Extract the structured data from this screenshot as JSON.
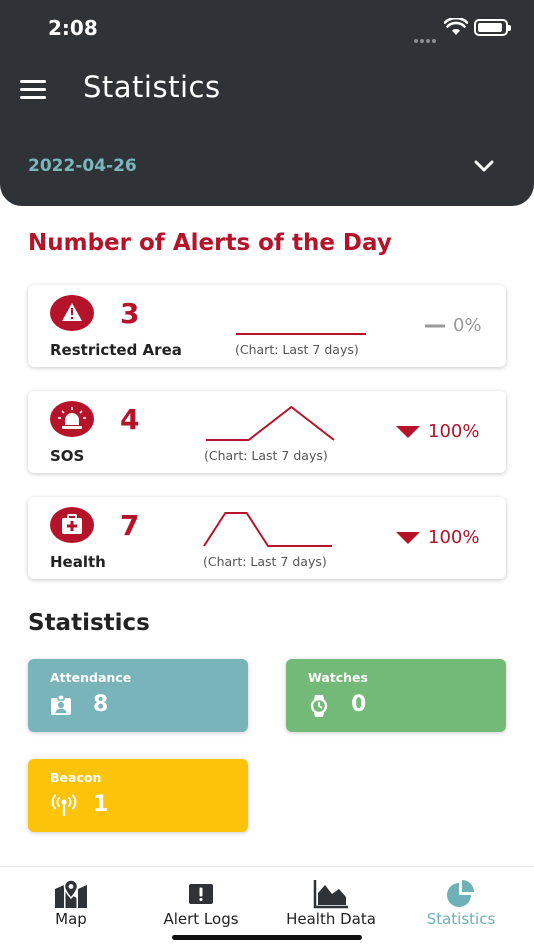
{
  "status": {
    "time": "2:08"
  },
  "header": {
    "title": "Statistics",
    "date": "2022-04-26"
  },
  "alerts": {
    "title": "Number of Alerts of the Day",
    "items": [
      {
        "label": "Restricted Area",
        "count": "3",
        "chart_note": "(Chart: Last 7 days)",
        "trend": "0%",
        "trend_direction": "neutral",
        "icon": "warning-triangle-icon",
        "series_last_7_days": [
          1,
          1,
          1,
          1,
          1,
          1,
          1
        ]
      },
      {
        "label": "SOS",
        "count": "4",
        "chart_note": "(Chart: Last 7 days)",
        "trend": "100%",
        "trend_direction": "down",
        "icon": "siren-icon",
        "series_last_7_days": [
          1,
          1,
          1,
          2,
          3,
          2,
          1
        ]
      },
      {
        "label": "Health",
        "count": "7",
        "chart_note": "(Chart: Last 7 days)",
        "trend": "100%",
        "trend_direction": "down",
        "icon": "first-aid-kit-icon",
        "series_last_7_days": [
          1,
          3,
          3,
          1,
          1,
          1,
          1
        ]
      }
    ]
  },
  "statistics": {
    "title": "Statistics",
    "cards": [
      {
        "label": "Attendance",
        "value": "8",
        "color": "#78b4ba",
        "icon": "id-badge-icon"
      },
      {
        "label": "Watches",
        "value": "0",
        "color": "#73b978",
        "icon": "watch-icon"
      },
      {
        "label": "Beacon",
        "value": "1",
        "color": "#fcc30b",
        "icon": "beacon-icon"
      }
    ]
  },
  "nav": {
    "items": [
      {
        "label": "Map",
        "icon": "map-pin-icon"
      },
      {
        "label": "Alert Logs",
        "icon": "alert-box-icon"
      },
      {
        "label": "Health Data",
        "icon": "area-chart-icon"
      },
      {
        "label": "Statistics",
        "icon": "pie-chart-icon",
        "active": true
      }
    ]
  },
  "colors": {
    "header_bg": "#2f3237",
    "accent_red": "#b5132a",
    "accent_teal": "#7ab7bd",
    "inactive_gray": "#9a9a9a"
  }
}
